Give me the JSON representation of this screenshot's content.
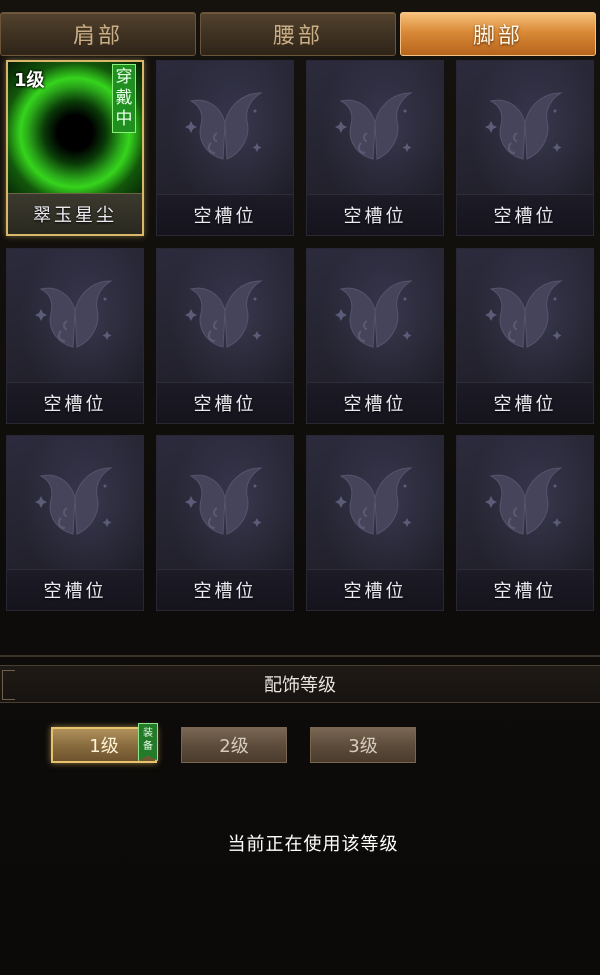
{
  "tabs": [
    {
      "label": "肩部",
      "active": false
    },
    {
      "label": "腰部",
      "active": false
    },
    {
      "label": "脚部",
      "active": true
    }
  ],
  "slots": [
    {
      "label": "翠玉星尘",
      "level": "1级",
      "status": "穿戴中",
      "equipped": true,
      "icon": "green-orb-icon"
    },
    {
      "label": "空槽位",
      "icon": "butterfly-icon"
    },
    {
      "label": "空槽位",
      "icon": "butterfly-icon"
    },
    {
      "label": "空槽位",
      "icon": "butterfly-icon"
    },
    {
      "label": "空槽位",
      "icon": "butterfly-icon"
    },
    {
      "label": "空槽位",
      "icon": "butterfly-icon"
    },
    {
      "label": "空槽位",
      "icon": "butterfly-icon"
    },
    {
      "label": "空槽位",
      "icon": "butterfly-icon"
    },
    {
      "label": "空槽位",
      "icon": "butterfly-icon"
    },
    {
      "label": "空槽位",
      "icon": "butterfly-icon"
    },
    {
      "label": "空槽位",
      "icon": "butterfly-icon"
    },
    {
      "label": "空槽位",
      "icon": "butterfly-icon"
    }
  ],
  "section": {
    "title": "配饰等级"
  },
  "levels": [
    {
      "label": "1级",
      "active": true,
      "badge": "装备"
    },
    {
      "label": "2级",
      "active": false
    },
    {
      "label": "3级",
      "active": false
    }
  ],
  "status_text": "当前正在使用该等级",
  "colors": {
    "active_tab": "#d98a37",
    "equipped_border": "#d9b86c",
    "wearing_tag": "#1f8f1f"
  }
}
